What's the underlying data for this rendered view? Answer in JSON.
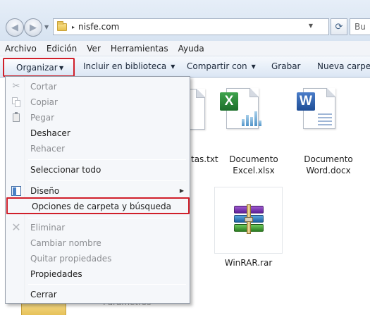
{
  "address_bar": {
    "path_separator": "▸",
    "path": "nisfe.com",
    "refresh_icon": "⟳",
    "search_placeholder": "Bu"
  },
  "menu_bar": [
    "Archivo",
    "Edición",
    "Ver",
    "Herramientas",
    "Ayuda"
  ],
  "toolbar": {
    "organize": "Organizar",
    "include_library": "Incluir en biblioteca",
    "share": "Compartir con",
    "burn": "Grabar",
    "new_folder": "Nueva carpeta"
  },
  "files": {
    "partial_txt": "tas.txt",
    "excel_line1": "Documento",
    "excel_line2": "Excel.xlsx",
    "excel_badge": "X",
    "word_line1": "Documento",
    "word_line2": "Word.docx",
    "word_badge": "W",
    "rar": "WinRAR.rar",
    "partial_bottom": "Parámetros"
  },
  "dropdown": {
    "cut": "Cortar",
    "copy": "Copiar",
    "paste": "Pegar",
    "undo": "Deshacer",
    "redo": "Rehacer",
    "select_all": "Seleccionar todo",
    "layout": "Diseño",
    "folder_options": "Opciones de carpeta y búsqueda",
    "delete": "Eliminar",
    "rename": "Cambiar nombre",
    "remove_properties": "Quitar propiedades",
    "properties": "Propiedades",
    "close": "Cerrar"
  },
  "colors": {
    "highlight_border": "#d01f2a",
    "excel_green": "#1b6e2a",
    "word_blue": "#1f4e96"
  }
}
